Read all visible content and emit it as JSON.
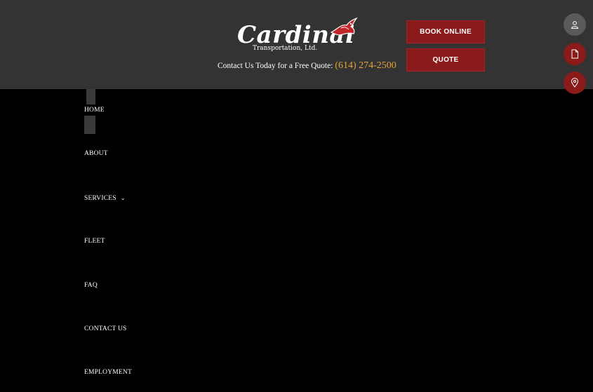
{
  "header": {
    "logo_script": "Cardinal",
    "logo_sub": "Transportation, Ltd.",
    "tagline_prefix": "Contact Us Today for a Free Quote:",
    "phone": "(614) 274-2500",
    "book_label": "BOOK ONLINE",
    "quote_label": "QUOTE"
  },
  "side_icons": [
    "account-icon",
    "document-icon",
    "location-pin-icon"
  ],
  "nav": {
    "items": [
      {
        "label": "HOME"
      },
      {
        "label": "ABOUT"
      },
      {
        "label": "SERVICES",
        "chevron": "⌄"
      },
      {
        "label": "FLEET"
      },
      {
        "label": "FAQ"
      },
      {
        "label": "CONTACT US"
      },
      {
        "label": "EMPLOYMENT"
      }
    ]
  },
  "colors": {
    "header_bg": "#333333",
    "accent_red": "#8b1a1a",
    "phone_gold": "#e0a43a",
    "page_bg": "#000000"
  }
}
